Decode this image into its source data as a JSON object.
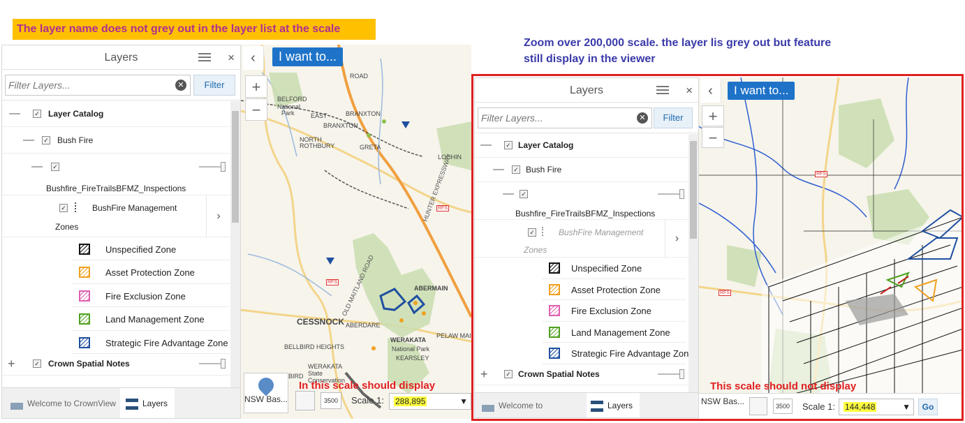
{
  "annotations": {
    "left_note": "The layer name does not grey out in the layer list at the scale",
    "right_note_line1": "Zoom over 200,000 scale. the layer lis grey out but feature",
    "right_note_line2": "still display in the viewer",
    "left_scale_note": "In this scale should display",
    "right_scale_note": "This scale should not display"
  },
  "panels": [
    {
      "title": "Layers",
      "close_glyph": "×",
      "filter_placeholder": "Filter Layers...",
      "filter_button": "Filter",
      "layer_catalog": "Layer Catalog",
      "bush_fire": "Bush Fire",
      "inspections": "Bushfire_FireTrailsBFMZ_Inspections",
      "bfmz_line1": "BushFire Management",
      "bfmz_line2": "Zones",
      "legend": [
        {
          "label": "Unspecified Zone",
          "symbol": "black-hatch-icon"
        },
        {
          "label": "Asset Protection Zone",
          "symbol": "orange-hatch-icon"
        },
        {
          "label": "Fire Exclusion Zone",
          "symbol": "pink-hatch-icon"
        },
        {
          "label": "Land Management Zone",
          "symbol": "green-hatch-icon"
        },
        {
          "label": "Strategic Fire Advantage Zone",
          "symbol": "blue-hatch-icon"
        }
      ],
      "crown_spatial": "Crown Spatial Notes",
      "tab_welcome": "Welcome to CrownView",
      "tab_layers": "Layers",
      "bfmz_greyed": false
    },
    {
      "title": "Layers",
      "close_glyph": "×",
      "filter_placeholder": "Filter Layers...",
      "filter_button": "Filter",
      "layer_catalog": "Layer Catalog",
      "bush_fire": "Bush Fire",
      "inspections": "Bushfire_FireTrailsBFMZ_Inspections",
      "bfmz_line1": "BushFire Management",
      "bfmz_line2": "Zones",
      "legend": [
        {
          "label": "Unspecified Zone",
          "symbol": "black-hatch-icon"
        },
        {
          "label": "Asset Protection Zone",
          "symbol": "orange-hatch-icon"
        },
        {
          "label": "Fire Exclusion Zone",
          "symbol": "pink-hatch-icon"
        },
        {
          "label": "Land Management Zone",
          "symbol": "green-hatch-icon"
        },
        {
          "label": "Strategic Fire Advantage Zone",
          "symbol": "blue-hatch-icon"
        }
      ],
      "crown_spatial": "Crown Spatial Notes",
      "tab_welcome": "Welcome to CrownView",
      "tab_layers": "Layers",
      "bfmz_greyed": true
    }
  ],
  "maps": [
    {
      "i_want_to": "I want to...",
      "zoom_in": "+",
      "zoom_out": "−",
      "collapse": "‹",
      "basemap_label": "NSW Bas...",
      "scale_prefix": "Scale 1:",
      "scale_value": "288,895",
      "go_label": "",
      "place_labels": [
        "BELFORD",
        "National",
        "Park",
        "EAST",
        "BRANXTON",
        "BRANXTON",
        "NORTH",
        "ROTHBURY",
        "GRETA",
        "LOCHIN",
        "ROAD",
        "ABERMAIN",
        "CESSNOCK",
        "ABERDARE",
        "WERAKATA",
        "National Park",
        "KEARSLEY",
        "PELAW MAIN",
        "BELLBIRD HEIGHTS",
        "BELLBIRD",
        "WERAKATA",
        "State",
        "Conservation",
        "HUNTER EXPRESSWAY",
        "OLD MAITLAND ROAD",
        "RFS",
        "3500"
      ]
    },
    {
      "i_want_to": "I want to...",
      "zoom_in": "+",
      "zoom_out": "−",
      "collapse": "‹",
      "basemap_label": "NSW Bas...",
      "scale_prefix": "Scale 1:",
      "scale_value": "144,448",
      "go_label": "Go",
      "place_labels": [
        "RFS",
        "3500"
      ]
    }
  ],
  "colors": {
    "annotation_yellow": "#ffc000",
    "annotation_magenta": "#b03090",
    "annotation_blue": "#3a3aaa",
    "red_highlight": "#e02020",
    "button_blue": "#1e73c8",
    "scale_highlight": "#ffff40"
  }
}
